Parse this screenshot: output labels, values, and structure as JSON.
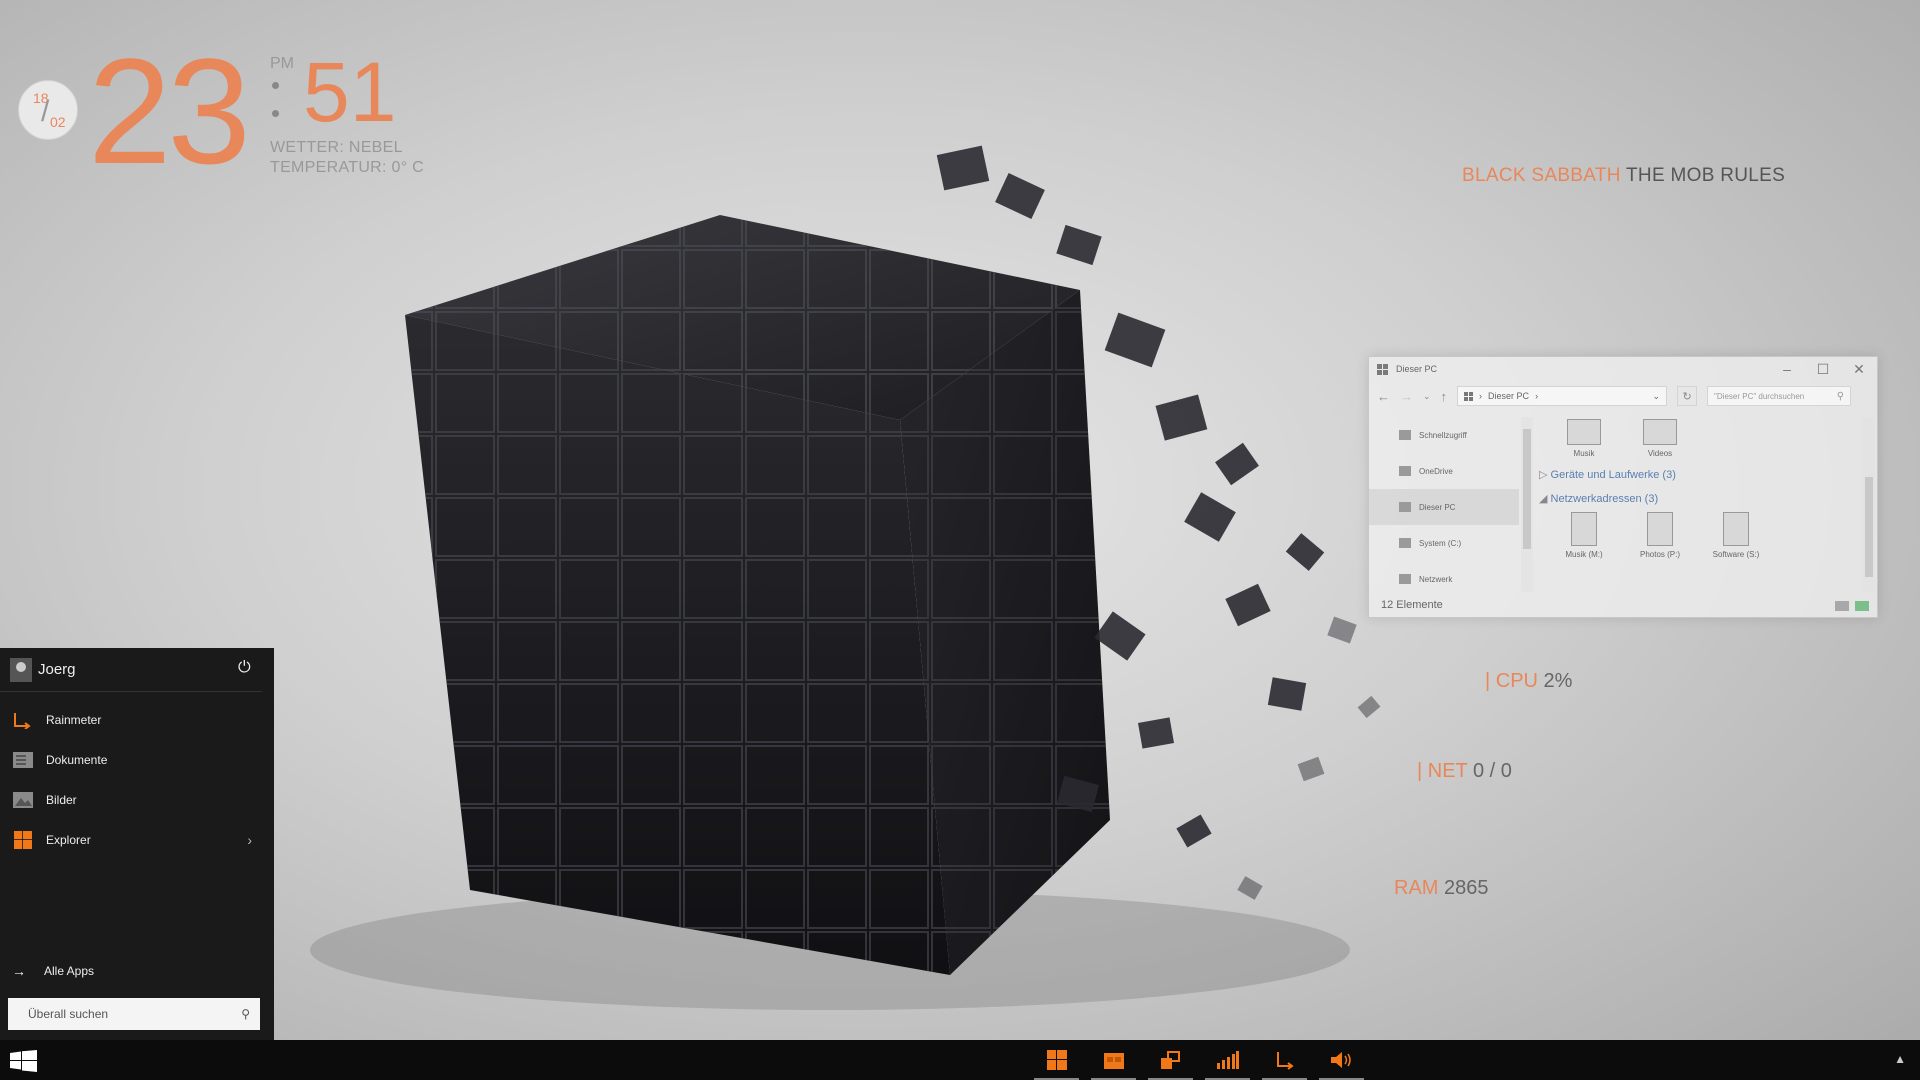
{
  "clock": {
    "day": "18",
    "month": "02",
    "hour": "23",
    "minute": "51",
    "ampm": "PM",
    "weather": "WETTER: NEBEL",
    "temperature": "TEMPERATUR: 0° C"
  },
  "now_playing": {
    "artist": "BLACK SABBATH",
    "track": "THE MOB RULES"
  },
  "meters": {
    "cpu_label": "| CPU",
    "cpu_value": "2%",
    "net_label": "| NET",
    "net_value": "0 / 0",
    "ram_label": "RAM",
    "ram_value": "2865"
  },
  "explorer": {
    "title": "Dieser PC",
    "address": "Dieser PC",
    "search_placeholder": "\"Dieser PC\" durchsuchen",
    "sidebar": [
      "Schnellzugriff",
      "OneDrive",
      "Dieser PC",
      "System (C:)",
      "Netzwerk"
    ],
    "folders": [
      "Musik",
      "Videos"
    ],
    "group_devices": "Geräte und Laufwerke (3)",
    "group_network": "Netzwerkadressen (3)",
    "network_drives": [
      "Musik (M:)",
      "Photos (P:)",
      "Software (S:)"
    ],
    "status": "12 Elemente"
  },
  "start_menu": {
    "user": "Joerg",
    "items": [
      {
        "label": "Rainmeter",
        "icon": "rainmeter-icon"
      },
      {
        "label": "Dokumente",
        "icon": "documents-icon"
      },
      {
        "label": "Bilder",
        "icon": "pictures-icon"
      },
      {
        "label": "Explorer",
        "icon": "explorer-icon"
      }
    ],
    "all_apps": "Alle Apps",
    "search_placeholder": "Überall suchen"
  },
  "colors": {
    "accent": "#e8875a",
    "taskbar": "#0c0c0c",
    "start_menu": "#1a1a1a",
    "orange_icon": "#f07818"
  }
}
